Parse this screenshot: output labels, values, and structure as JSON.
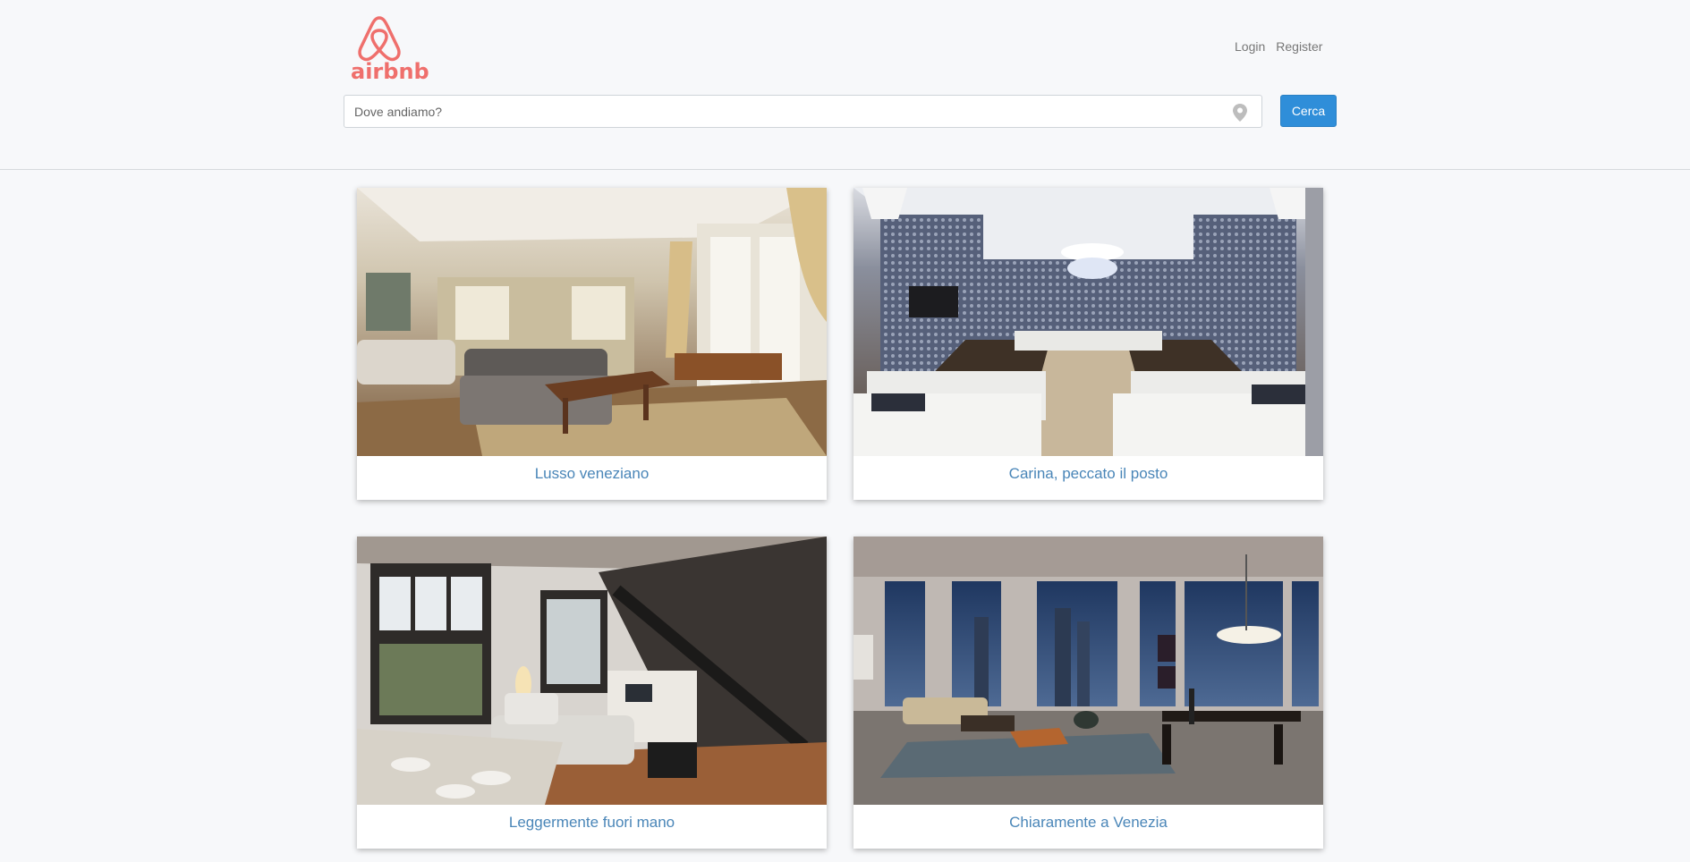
{
  "brand": {
    "name": "airbnb",
    "color": "#ef6f6c"
  },
  "nav": {
    "login": "Login",
    "register": "Register"
  },
  "search": {
    "placeholder": "Dove andiamo?",
    "value": "",
    "icon": "map-pin-icon",
    "button_label": "Cerca",
    "button_color": "#2f8ed9"
  },
  "listings": [
    {
      "title": "Lusso veneziano",
      "image": "classic-living-room-photo"
    },
    {
      "title": "Carina, peccato il posto",
      "image": "wallpaper-lounge-photo"
    },
    {
      "title": "Leggermente fuori mano",
      "image": "loft-staircase-photo"
    },
    {
      "title": "Chiaramente a Venezia",
      "image": "night-city-living-room-photo"
    }
  ]
}
